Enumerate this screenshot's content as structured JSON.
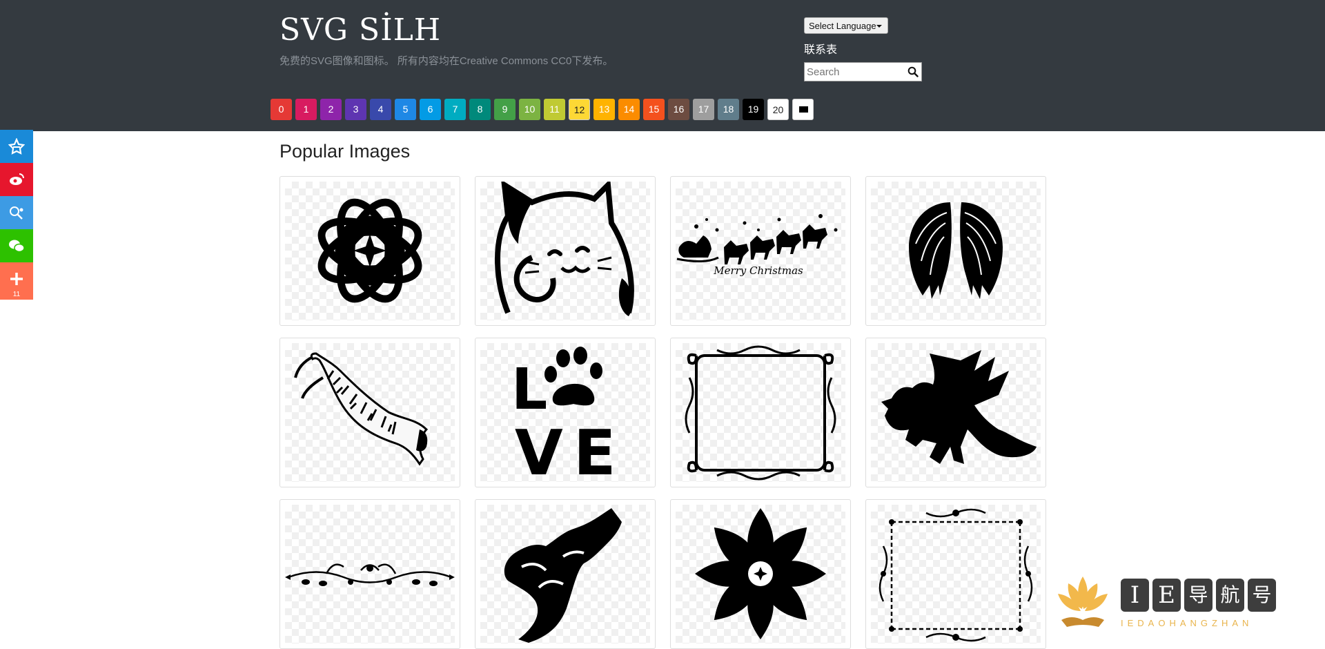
{
  "header": {
    "site_title": "SVG SİLH",
    "tagline": "免费的SVG图像和图标。 所有内容均在Creative Commons CC0下发布。",
    "language_select": "Select Language",
    "contact_link": "联系表",
    "search": {
      "placeholder": "Search",
      "value": ""
    }
  },
  "color_filters": [
    {
      "label": "0",
      "color": "#e53935"
    },
    {
      "label": "1",
      "color": "#d81b60"
    },
    {
      "label": "2",
      "color": "#8e24aa"
    },
    {
      "label": "3",
      "color": "#5e35b1"
    },
    {
      "label": "4",
      "color": "#3949ab"
    },
    {
      "label": "5",
      "color": "#1e88e5"
    },
    {
      "label": "6",
      "color": "#039be5"
    },
    {
      "label": "7",
      "color": "#00acc1"
    },
    {
      "label": "8",
      "color": "#00897b"
    },
    {
      "label": "9",
      "color": "#43a047"
    },
    {
      "label": "10",
      "color": "#7cb342"
    },
    {
      "label": "11",
      "color": "#c0ca33"
    },
    {
      "label": "12",
      "color": "#fdd835"
    },
    {
      "label": "13",
      "color": "#ffb300"
    },
    {
      "label": "14",
      "color": "#fb8c00"
    },
    {
      "label": "15",
      "color": "#f4511e"
    },
    {
      "label": "16",
      "color": "#6d4c41"
    },
    {
      "label": "17",
      "color": "#9e9e9e"
    },
    {
      "label": "18",
      "color": "#607d8b"
    },
    {
      "label": "19",
      "color": "#000000"
    },
    {
      "label": "20",
      "color": "#ffffff"
    },
    {
      "label": "",
      "color": "#ffffff",
      "icon": "black-fill-icon"
    }
  ],
  "share_bar": [
    {
      "icon": "favorite-icon",
      "color": "#1a8ad8"
    },
    {
      "icon": "weibo-icon",
      "color": "#e6162d"
    },
    {
      "icon": "qq-zone-icon",
      "color": "#3d9be4"
    },
    {
      "icon": "wechat-icon",
      "color": "#2dc100"
    },
    {
      "icon": "plus-icon",
      "color": "#ff6f4f",
      "count": "11"
    }
  ],
  "main": {
    "section_title": "Popular Images",
    "images": [
      {
        "name": "mandala",
        "icon": "mandala-icon"
      },
      {
        "name": "lucky cat",
        "icon": "cat-icon"
      },
      {
        "name": "santa sleigh merry christmas",
        "icon": "sleigh-icon",
        "caption": "Merry Christmas"
      },
      {
        "name": "angel wings",
        "icon": "wings-icon"
      },
      {
        "name": "tiger",
        "icon": "tiger-icon"
      },
      {
        "name": "love paw",
        "icon": "love-paw-icon",
        "letters": [
          "L",
          "V",
          "E"
        ]
      },
      {
        "name": "ornate frame",
        "icon": "frame-icon"
      },
      {
        "name": "dragon",
        "icon": "dragon-icon"
      },
      {
        "name": "flourish divider",
        "icon": "divider-icon"
      },
      {
        "name": "howling wolf",
        "icon": "wolf-icon"
      },
      {
        "name": "tribal flower",
        "icon": "flower-icon"
      },
      {
        "name": "ornate square frame",
        "icon": "square-frame-icon"
      }
    ]
  },
  "watermark": {
    "chars": [
      "I",
      "E",
      "导",
      "航",
      "号"
    ],
    "subtitle": "IEDAOHANGZHAN"
  }
}
